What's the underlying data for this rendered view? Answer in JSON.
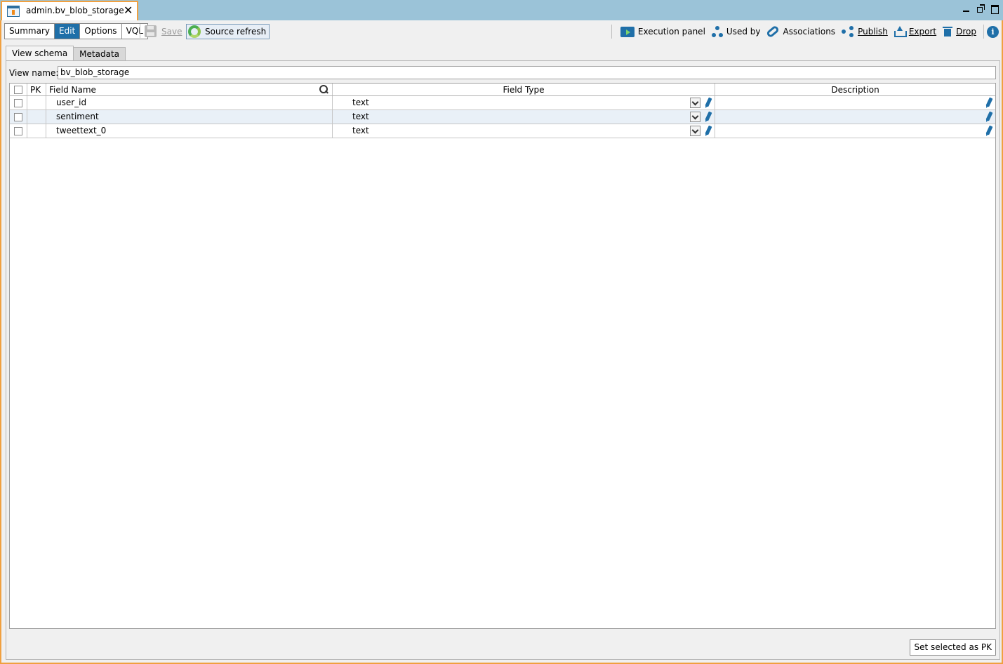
{
  "tab": {
    "title": "admin.bv_blob_storage"
  },
  "toolbar": {
    "segments": [
      "Summary",
      "Edit",
      "Options",
      "VQL"
    ],
    "save_label": "Save",
    "refresh_label": "Source refresh",
    "execution_panel": "Execution panel",
    "used_by": "Used by",
    "associations": "Associations",
    "publish": "Publish",
    "export": "Export",
    "drop": "Drop",
    "info_glyph": "i"
  },
  "subtabs": [
    "View schema",
    "Metadata"
  ],
  "view_name": {
    "label": "View name:",
    "value": "bv_blob_storage"
  },
  "grid": {
    "headers": {
      "pk": "PK",
      "field_name": "Field Name",
      "field_type": "Field Type",
      "description": "Description"
    },
    "rows": [
      {
        "name": "user_id",
        "type": "text",
        "description": ""
      },
      {
        "name": "sentiment",
        "type": "text",
        "description": ""
      },
      {
        "name": "tweettext_0",
        "type": "text",
        "description": ""
      }
    ]
  },
  "footer": {
    "set_pk_label": "Set selected as PK"
  },
  "colors": {
    "accent": "#1f6fa8",
    "tab_border": "#f0a040",
    "titlebar": "#9bc3d8",
    "row_alt": "#e9f0f7"
  },
  "icons": [
    "view-icon",
    "close-icon",
    "floppy-icon",
    "refresh-icon",
    "execution-panel-icon",
    "used-by-icon",
    "link-icon",
    "share-icon",
    "export-icon",
    "trash-icon",
    "info-icon",
    "search-icon",
    "dropdown-icon",
    "pencil-icon"
  ]
}
